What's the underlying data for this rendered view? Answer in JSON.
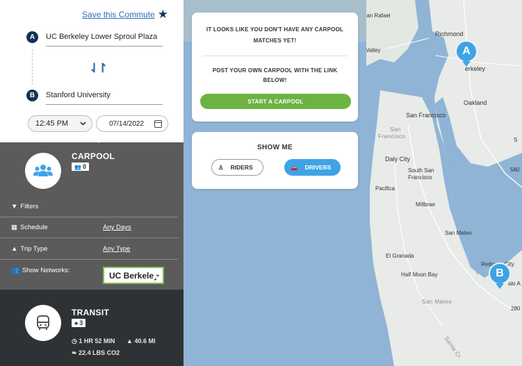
{
  "commute": {
    "save_label": "Save this Commute",
    "origin_pin": "A",
    "origin": "UC Berkeley Lower Sproul Plaza",
    "destination_pin": "B",
    "destination": "Stanford University",
    "time": "12:45 PM",
    "date": "07/14/2022"
  },
  "carpool": {
    "title": "CARPOOL",
    "count": "0",
    "filters_label": "Filters",
    "schedule_label": "Schedule",
    "schedule_value": "Any Days",
    "trip_type_label": "Trip Type",
    "trip_type_value": "Any Type",
    "networks_label": "Show Networks:",
    "networks_value": "UC Berkeley"
  },
  "transit": {
    "title": "TRANSIT",
    "count": "3",
    "duration": "1 HR 52 MIN",
    "distance": "40.6 MI",
    "co2": "22.4 LBS CO2"
  },
  "matches_card": {
    "line1": "IT LOOKS LIKE YOU DON'T HAVE ANY CARPOOL",
    "line2": "MATCHES YET!",
    "line3": "POST YOUR OWN CARPOOL WITH THE LINK",
    "line4": "BELOW!",
    "button": "START A CARPOOL"
  },
  "show_me": {
    "title": "SHOW ME",
    "riders": "RIDERS",
    "drivers": "DRIVERS"
  },
  "map": {
    "labels": {
      "san_rafael": "San Rafael",
      "mill_valley": "Mill Valley",
      "richmond": "Richmond",
      "berkeley": "erkeley",
      "oakland": "Oakland",
      "san_francisco": "San Francisco",
      "san_francisco_area_1": "San",
      "san_francisco_area_2": "Francisco",
      "daly_city": "Daly City",
      "south_sf_1": "South San",
      "south_sf_2": "Francisco",
      "pacifica": "Pacifica",
      "millbrae": "Millbrae",
      "san_mateo": "San Mateo",
      "el_granada": "El Granada",
      "half_moon_bay": "Half Moon Bay",
      "san_mateo_county": "San Mateo",
      "redwood_1": "Redw",
      "redwood_2": "City",
      "palo_alto": "alo A",
      "hwy_580": "580",
      "hwy_280": "280",
      "santa_cruz": "Santa Cr",
      "partial_s": "S"
    },
    "marker_a": "A",
    "marker_b": "B"
  },
  "colors": {
    "navy": "#15305a",
    "link_blue": "#2c6db3",
    "carpool_bg": "#5b5b5b",
    "transit_bg": "#2f3234",
    "green": "#6cb344",
    "accent_blue": "#3fa3e6",
    "water": "#8fb4d6",
    "land": "#e8ebe7"
  }
}
